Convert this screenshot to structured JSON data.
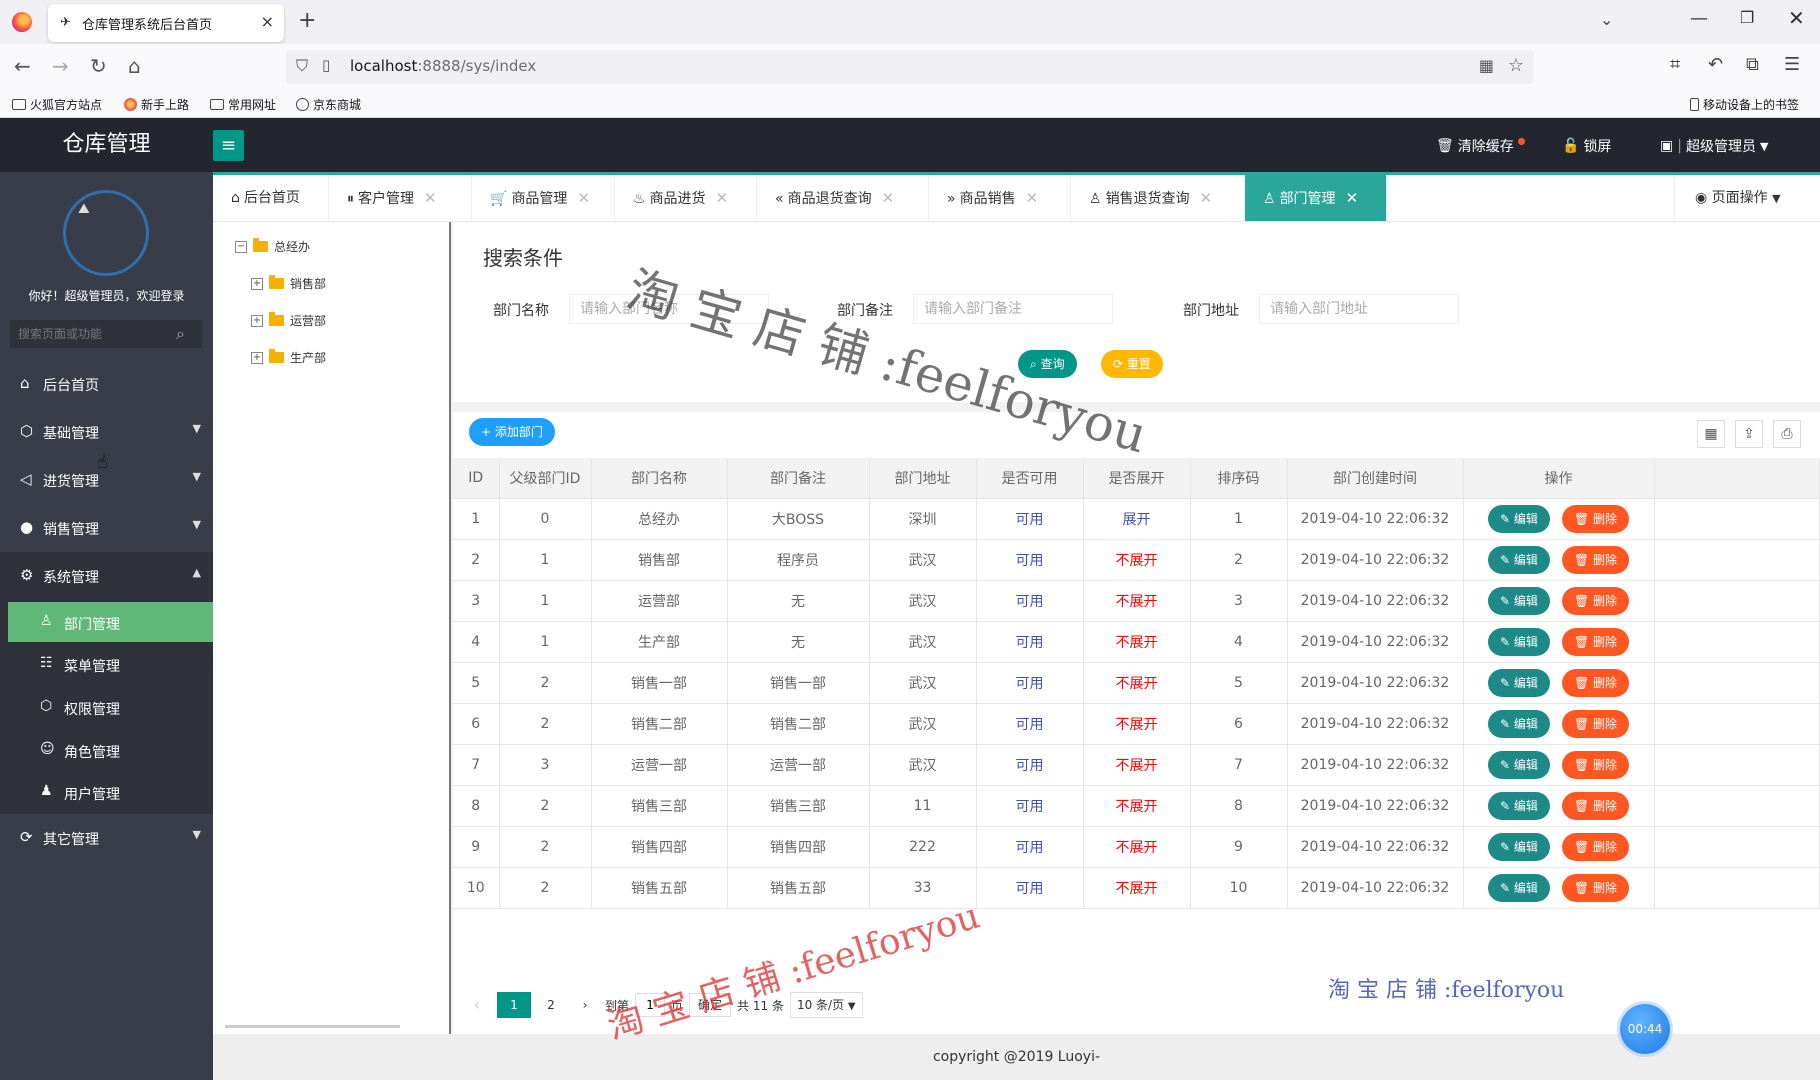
{
  "browser": {
    "tab_title": "仓库管理系统后台首页",
    "tab_close": "×",
    "new_tab": "+",
    "url_host": "localhost",
    "url_path": ":8888/sys/index",
    "bookmarks": [
      "火狐官方站点",
      "新手上路",
      "常用网址",
      "京东商城"
    ],
    "mobile_bookmarks": "移动设备上的书签"
  },
  "header": {
    "logo": "仓库管理",
    "menu_toggle": "≡",
    "clear_cache": "清除缓存",
    "lock_screen": "锁屏",
    "user": "超级管理员"
  },
  "sidebar": {
    "welcome": "你好！超级管理员，欢迎登录",
    "search_placeholder": "搜索页面或功能",
    "menu": [
      {
        "label": "后台首页",
        "icon": "home-icon"
      },
      {
        "label": "基础管理",
        "icon": "cube-icon"
      },
      {
        "label": "进货管理",
        "icon": "volume-icon"
      },
      {
        "label": "销售管理",
        "icon": "chat-icon"
      },
      {
        "label": "系统管理",
        "icon": "gear-icon"
      },
      {
        "label": "其它管理",
        "icon": "refresh-icon"
      }
    ],
    "submenu": [
      {
        "label": "部门管理",
        "icon": "user-icon"
      },
      {
        "label": "菜单管理",
        "icon": "list-icon"
      },
      {
        "label": "权限管理",
        "icon": "cube-icon"
      },
      {
        "label": "角色管理",
        "icon": "smile-icon"
      },
      {
        "label": "用户管理",
        "icon": "person-icon"
      }
    ]
  },
  "tabs": [
    {
      "label": "后台首页"
    },
    {
      "label": "客户管理"
    },
    {
      "label": "商品管理"
    },
    {
      "label": "商品进货"
    },
    {
      "label": "商品退货查询"
    },
    {
      "label": "商品销售"
    },
    {
      "label": "销售退货查询"
    },
    {
      "label": "部门管理"
    }
  ],
  "page_operation": "页面操作",
  "tree": {
    "root": "总经办",
    "children": [
      "销售部",
      "运营部",
      "生产部"
    ]
  },
  "search": {
    "title": "搜索条件",
    "name_label": "部门名称",
    "name_placeholder": "请输入部门名称",
    "remark_label": "部门备注",
    "remark_placeholder": "请输入部门备注",
    "address_label": "部门地址",
    "address_placeholder": "请输入部门地址",
    "query_button": "查询",
    "reset_button": "重置"
  },
  "add_button": "添加部门",
  "table": {
    "headers": [
      "ID",
      "父级部门ID",
      "部门名称",
      "部门备注",
      "部门地址",
      "是否可用",
      "是否展开",
      "排序码",
      "部门创建时间",
      "操作"
    ],
    "edit_label": "编辑",
    "delete_label": "删除",
    "rows": [
      [
        "1",
        "0",
        "总经办",
        "大BOSS",
        "深圳",
        "可用",
        "展开",
        "1",
        "2019-04-10 22:06:32"
      ],
      [
        "2",
        "1",
        "销售部",
        "程序员",
        "武汉",
        "可用",
        "不展开",
        "2",
        "2019-04-10 22:06:32"
      ],
      [
        "3",
        "1",
        "运营部",
        "无",
        "武汉",
        "可用",
        "不展开",
        "3",
        "2019-04-10 22:06:32"
      ],
      [
        "4",
        "1",
        "生产部",
        "无",
        "武汉",
        "可用",
        "不展开",
        "4",
        "2019-04-10 22:06:32"
      ],
      [
        "5",
        "2",
        "销售一部",
        "销售一部",
        "武汉",
        "可用",
        "不展开",
        "5",
        "2019-04-10 22:06:32"
      ],
      [
        "6",
        "2",
        "销售二部",
        "销售二部",
        "武汉",
        "可用",
        "不展开",
        "6",
        "2019-04-10 22:06:32"
      ],
      [
        "7",
        "3",
        "运营一部",
        "运营一部",
        "武汉",
        "可用",
        "不展开",
        "7",
        "2019-04-10 22:06:32"
      ],
      [
        "8",
        "2",
        "销售三部",
        "销售三部",
        "11",
        "可用",
        "不展开",
        "8",
        "2019-04-10 22:06:32"
      ],
      [
        "9",
        "2",
        "销售四部",
        "销售四部",
        "222",
        "可用",
        "不展开",
        "9",
        "2019-04-10 22:06:32"
      ],
      [
        "10",
        "2",
        "销售五部",
        "销售五部",
        "33",
        "可用",
        "不展开",
        "10",
        "2019-04-10 22:06:32"
      ]
    ]
  },
  "pagination": {
    "pages": [
      "1",
      "2"
    ],
    "goto_prefix": "到第",
    "goto_value": "1",
    "goto_suffix": "页",
    "confirm": "确定",
    "total": "共 11 条",
    "page_size": "10 条/页"
  },
  "footer": "copyright @2019 Luoyi-",
  "timer": "00:44",
  "watermarks": [
    "淘 宝 店 铺 :feelforyou",
    "淘 宝 店 铺 :feelforyou",
    "淘 宝 店 铺 :feelforyou"
  ],
  "colors": {
    "header_bg": "#23262e",
    "sidebar_bg": "#393d49",
    "accent": "#009688",
    "active_menu": "#5fb878",
    "edit_btn": "#1e8a88",
    "delete_btn": "#ff5722",
    "add_btn": "#1e9fff",
    "reset_btn": "#ffb800"
  }
}
